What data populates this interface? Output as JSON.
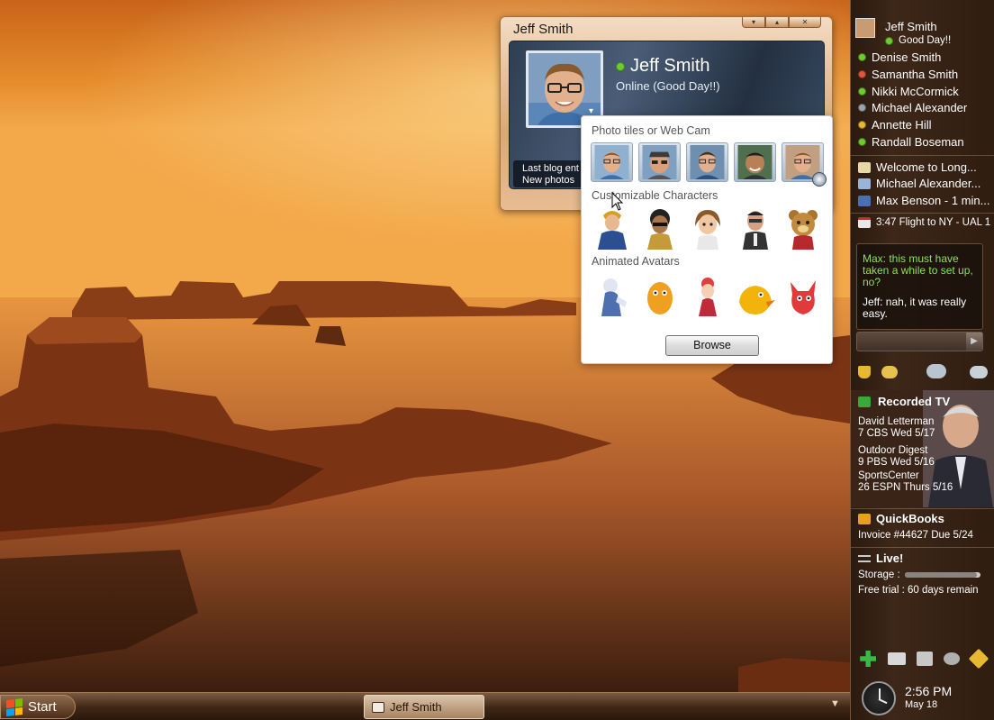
{
  "taskbar": {
    "start_label": "Start",
    "task_item_label": "Jeff Smith"
  },
  "contact_window": {
    "title": "Jeff Smith",
    "controls": [
      "▾",
      "▴",
      "✕"
    ],
    "name": "Jeff Smith",
    "status": "Online (Good Day!!)",
    "feed_line1": "Last blog ent",
    "feed_line2": "New photos"
  },
  "picker": {
    "section_photos": "Photo tiles or Web Cam",
    "section_characters": "Customizable Characters",
    "section_animated": "Animated Avatars",
    "browse_label": "Browse"
  },
  "sidebar": {
    "user": {
      "name": "Jeff Smith",
      "status": "Good Day!!"
    },
    "contacts": [
      {
        "name": "Denise Smith",
        "color": "#6ccc2e"
      },
      {
        "name": "Samantha Smith",
        "color": "#e0563a"
      },
      {
        "name": "Nikki McCormick",
        "color": "#6ccc2e"
      },
      {
        "name": "Michael Alexander",
        "color": "#9aa4b0"
      },
      {
        "name": "Annette Hill",
        "color": "#e8b830"
      },
      {
        "name": "Randall Boseman",
        "color": "#6ccc2e"
      }
    ],
    "notifications": [
      {
        "text": "Welcome to Long...",
        "icon": "envelope-icon"
      },
      {
        "text": "Michael Alexander...",
        "icon": "people-icon"
      },
      {
        "text": "Max Benson - 1 min...",
        "icon": "phone-icon"
      }
    ],
    "calendar_item": "3:47 Flight to NY - UAL 1",
    "chat": {
      "max_msg": "Max:  this must have taken a while to set up, no?",
      "jeff_msg": "Jeff: nah, it was really easy."
    },
    "recorded_tv": {
      "title": "Recorded TV",
      "items": [
        {
          "line1": "David Letterman",
          "line2": "7 CBS Wed 5/17"
        },
        {
          "line1": "Outdoor Digest",
          "line2": "9 PBS Wed 5/16"
        },
        {
          "line1": "SportsCenter",
          "line2": "26 ESPN Thurs 5/16"
        }
      ]
    },
    "quickbooks": {
      "title": "QuickBooks",
      "line": "Invoice #44627 Due 5/24"
    },
    "live": {
      "title": "Live!",
      "storage_label": "Storage :",
      "storage_fraction": 0.95,
      "trial": "Free trial :  60 days remain"
    },
    "clock": {
      "time": "2:56  PM",
      "date": "May 18"
    }
  }
}
